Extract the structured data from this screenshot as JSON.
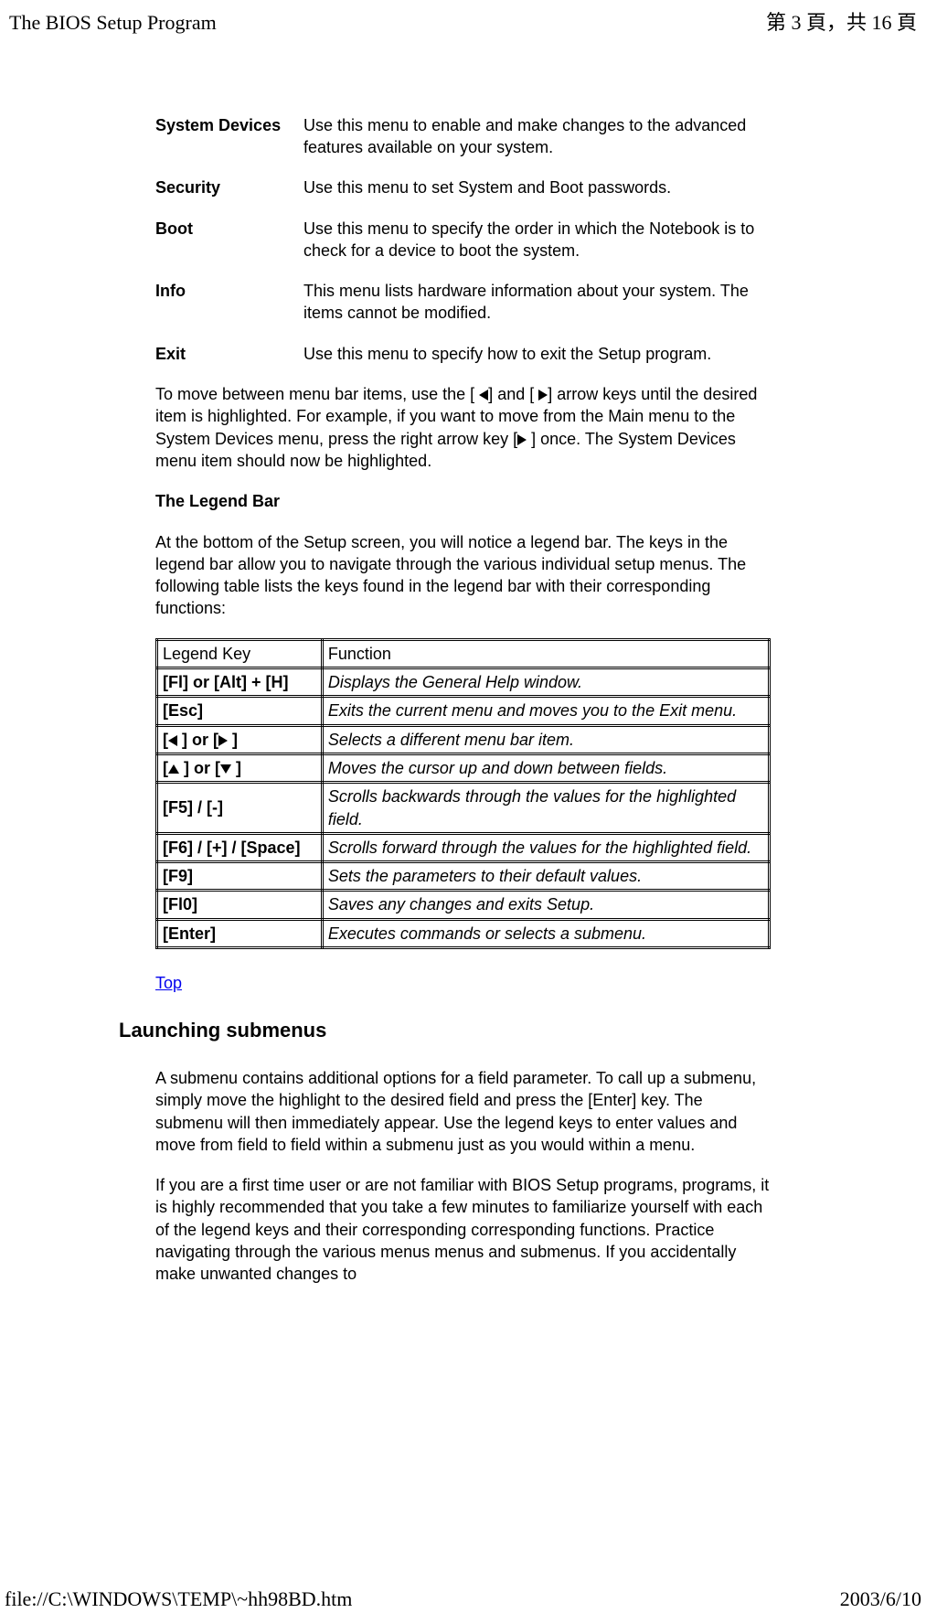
{
  "header": {
    "title": "The BIOS Setup Program",
    "page_info": "第 3 頁，共 16 頁"
  },
  "menus": [
    {
      "label": "System Devices",
      "desc": "Use this menu to enable and make changes to the advanced features available on your system."
    },
    {
      "label": "Security",
      "desc": "Use this menu to set System and Boot passwords."
    },
    {
      "label": "Boot",
      "desc": "Use this menu to specify the order in which the Notebook is to check for a device to boot the system."
    },
    {
      "label": "Info",
      "desc": "This menu lists hardware information about your system. The items cannot be modified."
    },
    {
      "label": "Exit",
      "desc": "Use this menu to specify how to exit the Setup program."
    }
  ],
  "nav_para_1": "To move between menu bar items, use the [ ",
  "nav_para_2": "] and [  ",
  "nav_para_3": "] arrow keys until the desired item is highlighted. For example, if you want to move from the Main menu to the System Devices menu, press the right arrow key [",
  "nav_para_4": " ] once. The System Devices menu item should now be highlighted.",
  "legend_heading": "The Legend Bar",
  "legend_intro": "At the bottom of the Setup screen, you will notice a legend bar. The keys in the legend bar allow you to navigate through the various individual setup menus. The following table lists the keys found in the legend bar with their corresponding functions:",
  "table": {
    "head_key": "Legend Key",
    "head_func": "Function",
    "rows": [
      {
        "key": "[Fl] or [Alt] + [H]",
        "func": "Displays the General Help window."
      },
      {
        "key": "[Esc]",
        "func": "Exits the current menu and moves you to the Exit menu."
      },
      {
        "key_prefix": "[",
        "key_mid": " ] or [",
        "key_suffix": " ]",
        "arrows": "lr",
        "func": "Selects a different menu bar item."
      },
      {
        "key_prefix": "[",
        "key_mid": " ] or [",
        "key_suffix": " ]",
        "arrows": "ud",
        "func": "Moves the cursor up and down between fields."
      },
      {
        "key": "[F5] / [-]",
        "func": "Scrolls backwards through the values for the highlighted field."
      },
      {
        "key": "[F6] / [+] / [Space]",
        "func": "Scrolls forward through the values for the highlighted field."
      },
      {
        "key": "[F9]",
        "func": "Sets the parameters to their default values."
      },
      {
        "key": "[Fl0]",
        "func": "Saves any changes and exits Setup."
      },
      {
        "key": "[Enter]",
        "func": "Executes commands or selects a submenu."
      }
    ]
  },
  "top_link": "Top",
  "section_heading": "Launching submenus",
  "submenu_para1": "A submenu contains additional options for a field parameter. To call up a submenu, simply move the highlight to the desired field and press the [Enter] key. The submenu will then immediately appear. Use the legend keys to enter values and move from field to field within a submenu just as you would within a menu.",
  "submenu_para2": "If you are a first time user or are not familiar with BIOS Setup programs, programs, it is highly recommended that you take a few minutes to familiarize yourself with each of the legend keys and their corresponding corresponding functions. Practice navigating through the various menus menus and submenus. If you accidentally make unwanted changes to",
  "footer": {
    "path": "file://C:\\WINDOWS\\TEMP\\~hh98BD.htm",
    "date": "2003/6/10"
  }
}
